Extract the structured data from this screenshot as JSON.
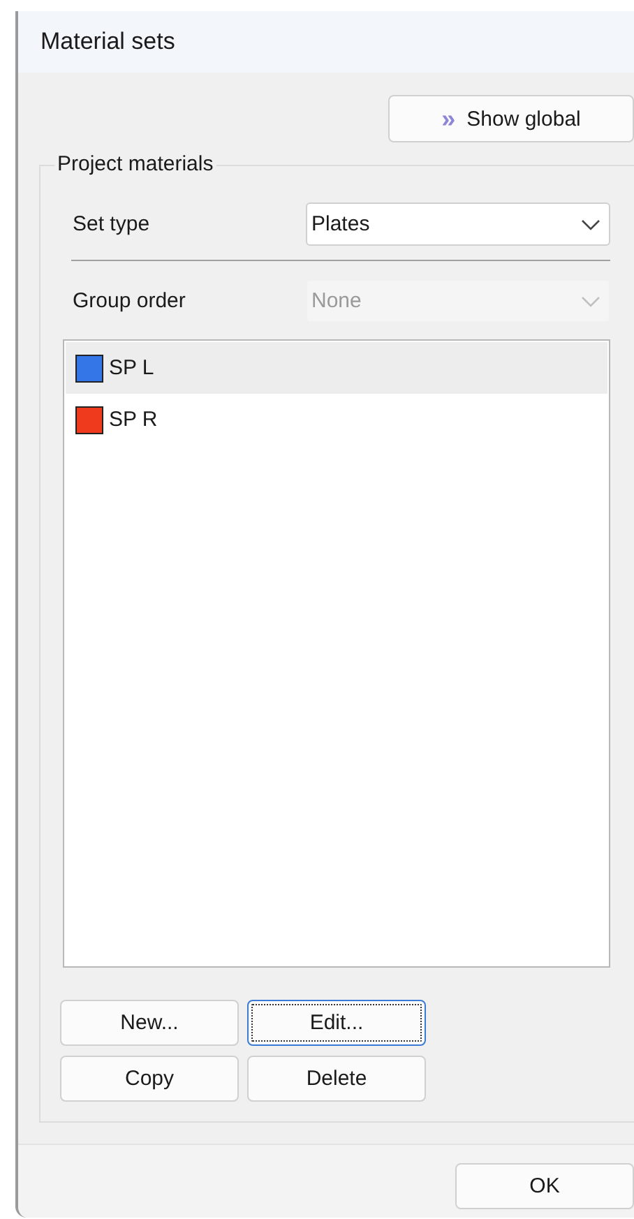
{
  "window": {
    "title": "Material sets"
  },
  "show_global_button": {
    "icon": "»",
    "label": "Show global"
  },
  "group": {
    "title": "Project materials",
    "set_type": {
      "label": "Set type",
      "value": "Plates",
      "disabled": false
    },
    "group_order": {
      "label": "Group order",
      "value": "None",
      "disabled": true
    },
    "items": [
      {
        "name": "SP L",
        "color": "#3475e8",
        "selected": true
      },
      {
        "name": "SP R",
        "color": "#f03a1e",
        "selected": false
      }
    ],
    "buttons": [
      {
        "label": "New...",
        "focused": false
      },
      {
        "label": "Edit...",
        "focused": true
      },
      {
        "label": "Copy",
        "focused": false
      },
      {
        "label": "Delete",
        "focused": false
      }
    ]
  },
  "footer": {
    "buttons": [
      {
        "label": "OK",
        "focused": false
      }
    ]
  }
}
